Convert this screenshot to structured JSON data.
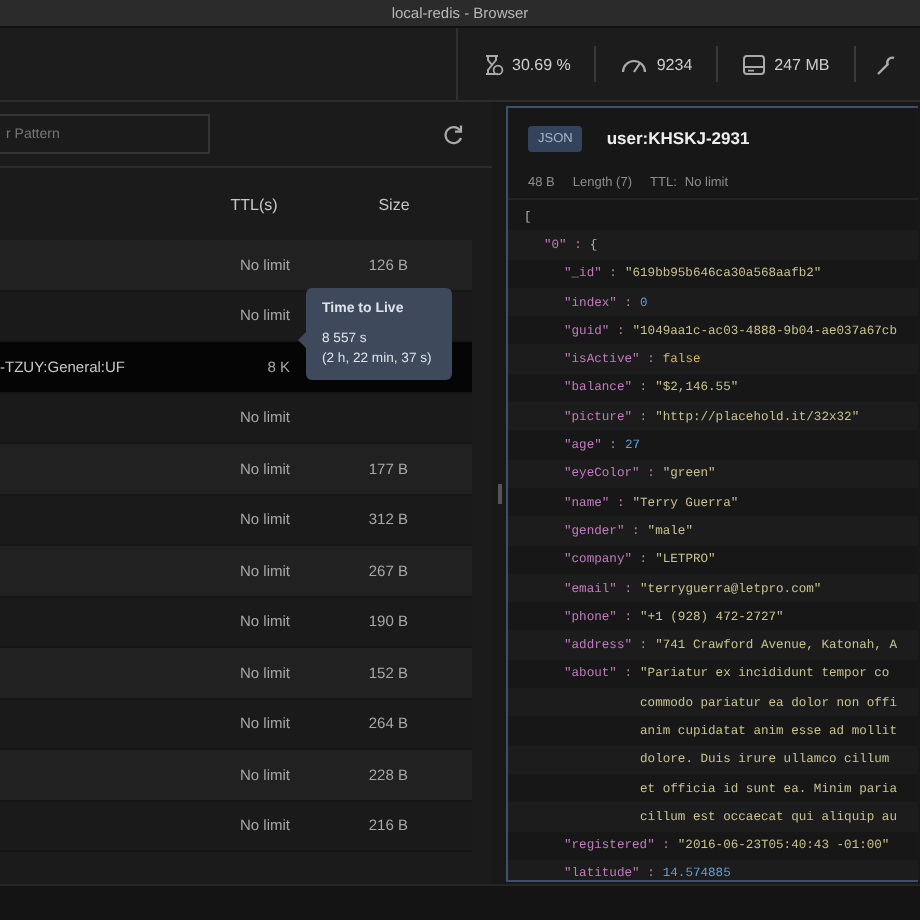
{
  "window": {
    "title": "local-redis - Browser"
  },
  "stats": [
    {
      "kind": "cpu",
      "value": "30.69 %"
    },
    {
      "kind": "ops",
      "value": "9234"
    },
    {
      "kind": "memory",
      "value": "247 MB"
    },
    {
      "kind": "tools"
    }
  ],
  "filter": {
    "placeholder": "r Pattern"
  },
  "table": {
    "columns": [
      "TTL(s)",
      "Size"
    ],
    "rows": [
      {
        "ttl": "No limit",
        "size": "126 B",
        "selected": false
      },
      {
        "ttl": "No limit",
        "selected": false
      },
      {
        "key": "-TZUY:General:UF",
        "ttl": "8 K",
        "selected": true
      },
      {
        "ttl": "No limit",
        "selected": false
      },
      {
        "ttl": "No limit",
        "size": "177 B",
        "selected": false
      },
      {
        "ttl": "No limit",
        "size": "312 B",
        "selected": false
      },
      {
        "ttl": "No limit",
        "size": "267 B",
        "selected": false
      },
      {
        "ttl": "No limit",
        "size": "190 B",
        "selected": false
      },
      {
        "ttl": "No limit",
        "size": "152 B",
        "selected": false
      },
      {
        "ttl": "No limit",
        "size": "264 B",
        "selected": false
      },
      {
        "ttl": "No limit",
        "size": "228 B",
        "selected": false
      },
      {
        "ttl": "No limit",
        "size": "216 B",
        "selected": false
      }
    ]
  },
  "tooltip": {
    "title": "Time to Live",
    "lines": [
      "8 557 s",
      "(2 h, 22 min, 37 s)"
    ]
  },
  "detail": {
    "type_badge": "JSON",
    "key": "user:KHSKJ-2931",
    "size": "48 B",
    "length": "Length (7)",
    "ttl_label": "TTL:",
    "ttl": "No limit",
    "code": {
      "text": "[",
      "children": [
        {
          "key": "\"0\" :",
          "value": "{",
          "children": [
            {
              "key": "\"_id\" :",
              "value": "\"619bb95b646ca30a568aafb2\"",
              "kind": "string"
            },
            {
              "key": "\"index\" :",
              "value": "0",
              "kind": "number"
            },
            {
              "key": "\"guid\" :",
              "value": "\"1049aa1c-ac03-4888-9b04-ae037a67cb",
              "kind": "string"
            },
            {
              "key": "\"isActive\" :",
              "value": "false",
              "kind": "boolean"
            },
            {
              "key": "\"balance\" :",
              "value": "\"$2,146.55\"",
              "kind": "string"
            },
            {
              "key": "\"picture\" :",
              "value": "\"http://placehold.it/32x32\"",
              "kind": "string"
            },
            {
              "key": "\"age\" :",
              "value": "27",
              "kind": "number"
            },
            {
              "key": "\"eyeColor\" :",
              "value": "\"green\"",
              "kind": "string"
            },
            {
              "key": "\"name\" :",
              "value": "\"Terry Guerra\"",
              "kind": "string"
            },
            {
              "key": "\"gender\" :",
              "value": "\"male\"",
              "kind": "string"
            },
            {
              "key": "\"company\" :",
              "value": "\"LETPRO\"",
              "kind": "string"
            },
            {
              "key": "\"email\" :",
              "value": "\"terryguerra@letpro.com\"",
              "kind": "string"
            },
            {
              "key": "\"phone\" :",
              "value": "\"+1 (928) 472-2727\"",
              "kind": "string"
            },
            {
              "key": "\"address\" :",
              "value": "\"741 Crawford Avenue, Katonah, A",
              "kind": "string"
            },
            {
              "key": "\"about\" :",
              "value": "\"Pariatur ex incididunt tempor co",
              "kind": "string",
              "continuation": [
                "commodo pariatur ea dolor non offi",
                "anim cupidatat anim esse ad mollit",
                "dolore. Duis irure ullamco cillum",
                "et officia id sunt ea. Minim paria",
                "cillum est occaecat qui aliquip au"
              ]
            },
            {
              "key": "\"registered\" :",
              "value": "\"2016-06-23T05:40:43 -01:00\"",
              "kind": "string"
            },
            {
              "key": "\"latitude\" :",
              "value": "14.574885",
              "kind": "number"
            }
          ]
        }
      ]
    }
  }
}
